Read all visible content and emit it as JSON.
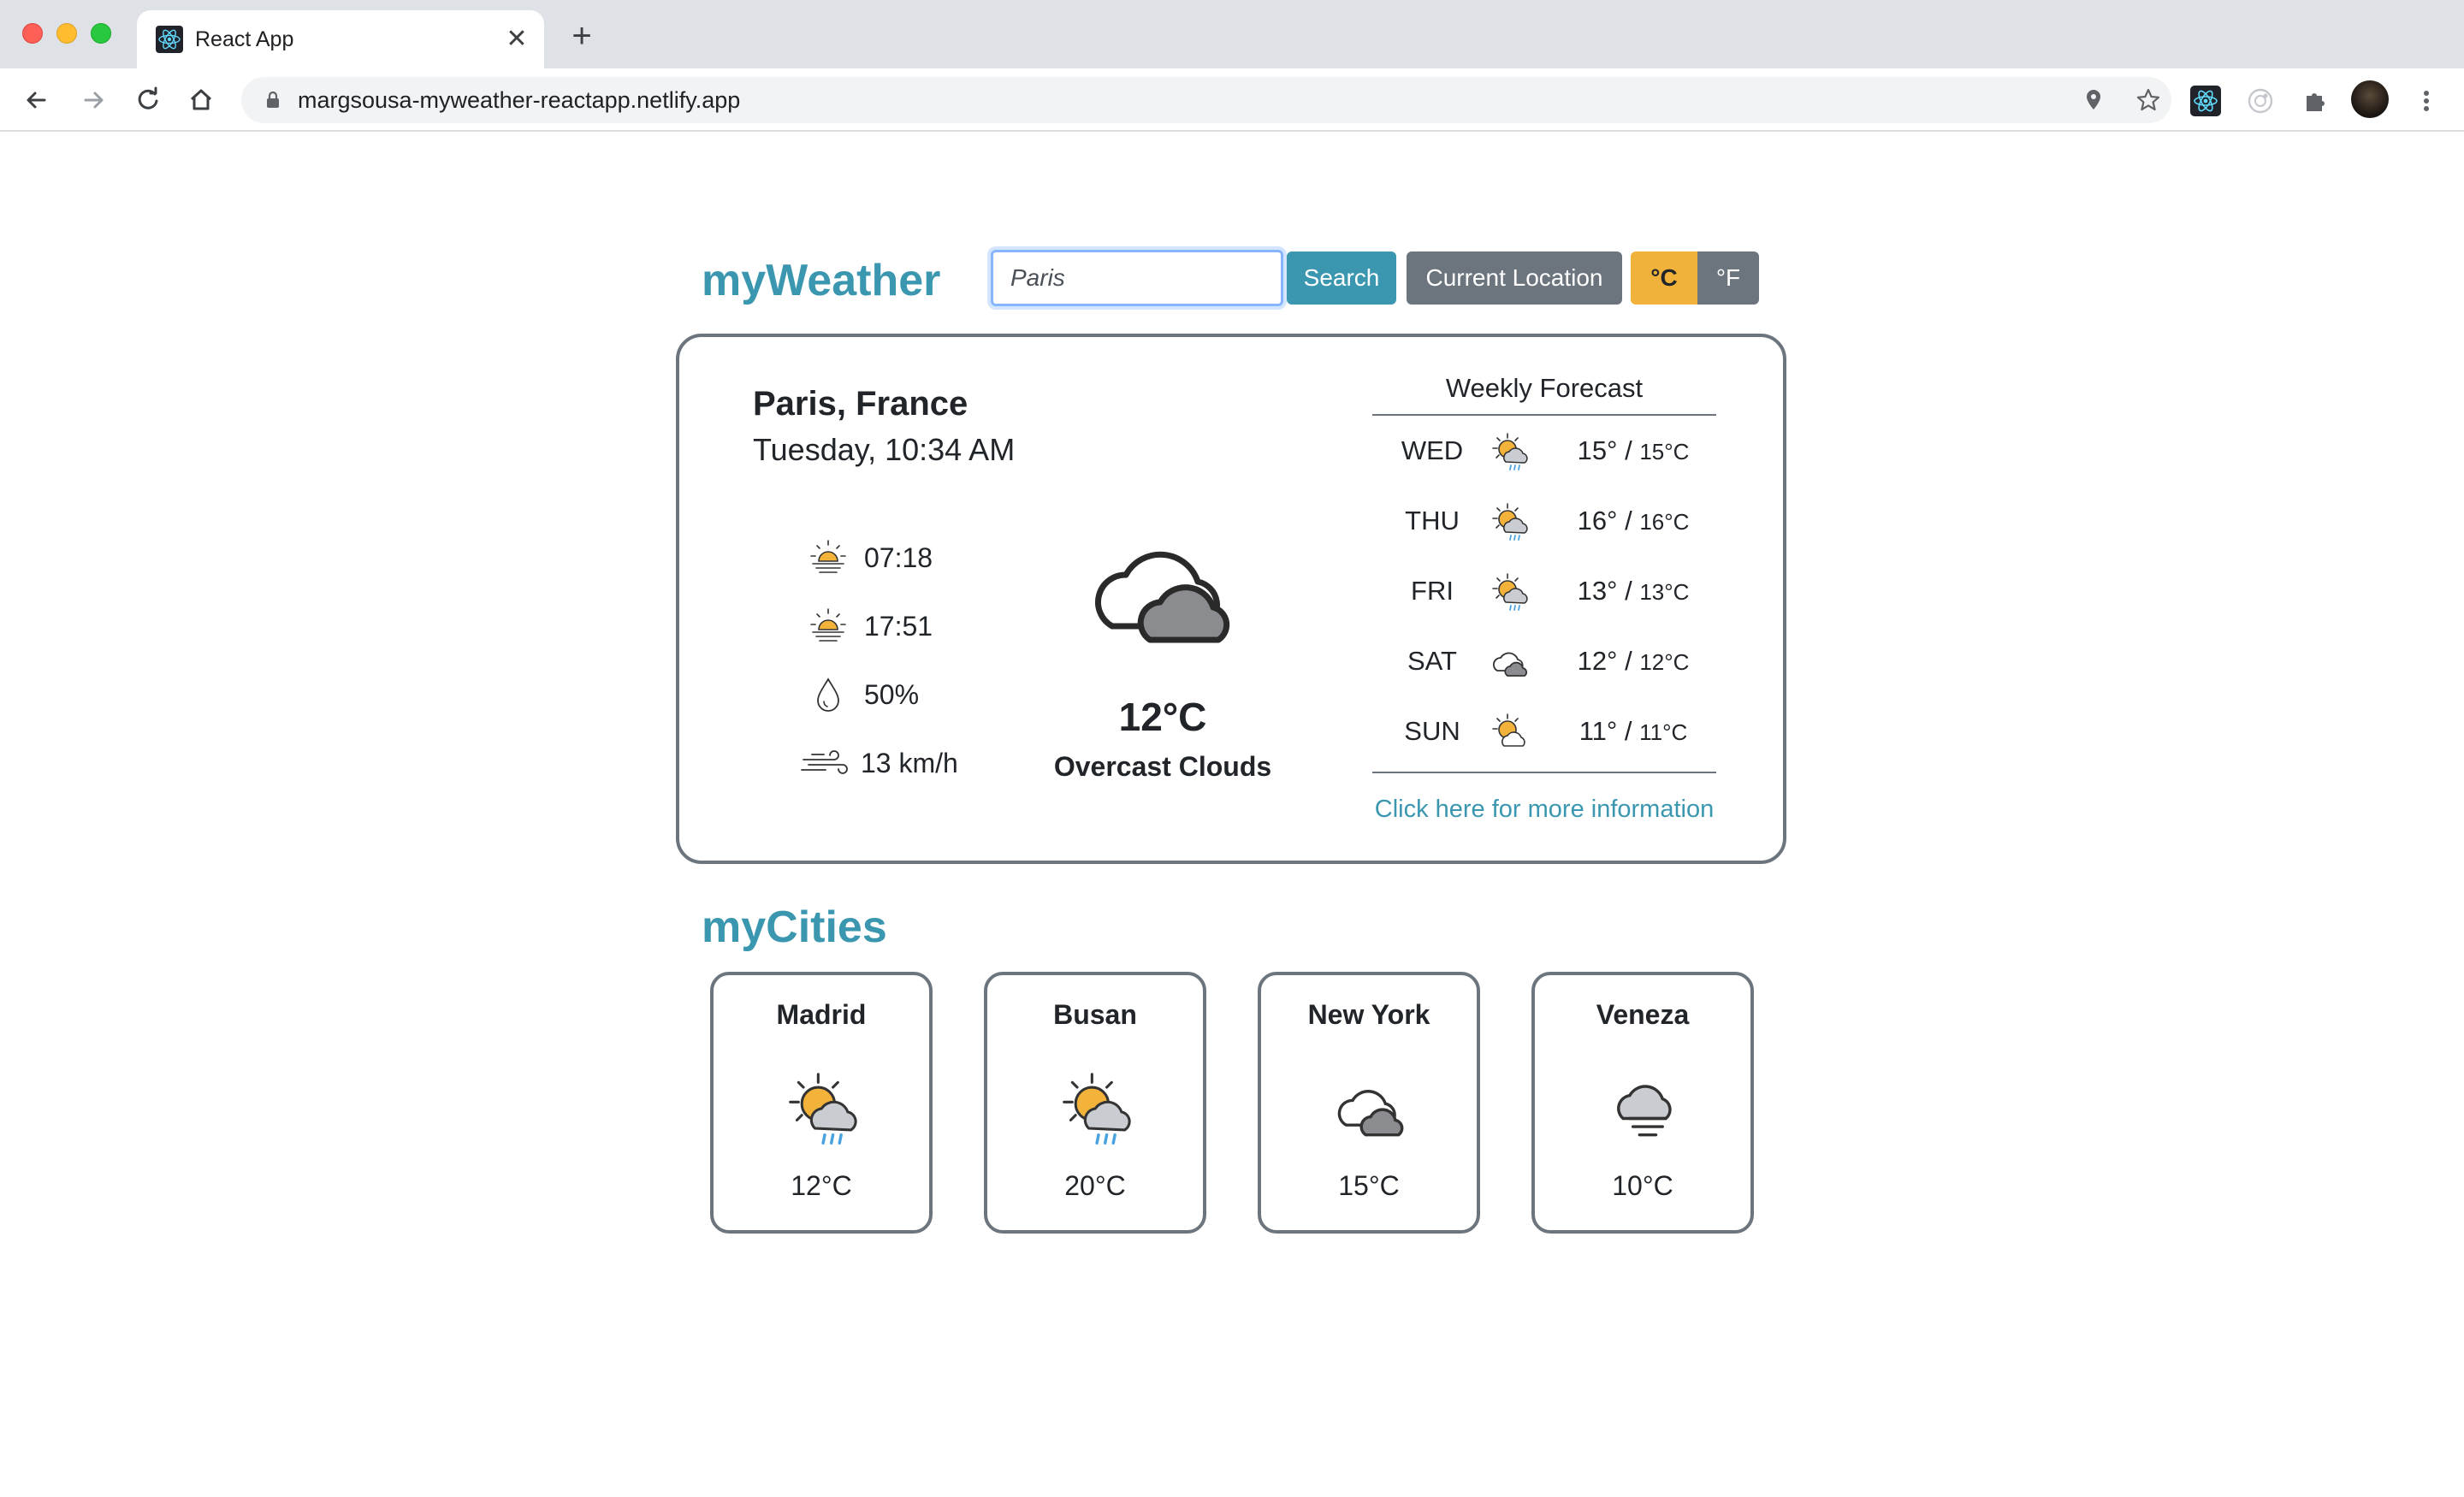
{
  "browser": {
    "tab_title": "React App",
    "url": "margsousa-myweather-reactapp.netlify.app"
  },
  "app": {
    "brand": "myWeather",
    "search": {
      "value": "Paris",
      "placeholder": ""
    },
    "search_button": "Search",
    "location_button": "Current Location",
    "unit_c": "°C",
    "unit_f": "°F"
  },
  "current": {
    "city": "Paris, France",
    "datetime": "Tuesday, 10:34 AM",
    "sunrise": "07:18",
    "sunset": "17:51",
    "humidity": "50%",
    "wind": "13 km/h",
    "temperature": "12°C",
    "description": "Overcast Clouds",
    "icon": "overcast-clouds-icon"
  },
  "forecast": {
    "title": "Weekly Forecast",
    "days": [
      {
        "day": "WED",
        "high": "15°",
        "low": "15°C",
        "icon": "sun-rain-icon"
      },
      {
        "day": "THU",
        "high": "16°",
        "low": "16°C",
        "icon": "sun-rain-icon"
      },
      {
        "day": "FRI",
        "high": "13°",
        "low": "13°C",
        "icon": "sun-rain-icon"
      },
      {
        "day": "SAT",
        "high": "12°",
        "low": "12°C",
        "icon": "cloud-icon"
      },
      {
        "day": "SUN",
        "high": "11°",
        "low": "11°C",
        "icon": "sun-cloud-icon"
      }
    ],
    "more_link": "Click here for more information"
  },
  "cities": {
    "title": "myCities",
    "items": [
      {
        "name": "Madrid",
        "temp": "12°C",
        "icon": "sun-rain-icon"
      },
      {
        "name": "Busan",
        "temp": "20°C",
        "icon": "sun-rain-icon"
      },
      {
        "name": "New York",
        "temp": "15°C",
        "icon": "cloud-icon"
      },
      {
        "name": "Veneza",
        "temp": "10°C",
        "icon": "mist-icon"
      }
    ]
  },
  "colors": {
    "brand": "#3a97af",
    "secondary": "#6c757d",
    "warning": "#f0b23a"
  }
}
